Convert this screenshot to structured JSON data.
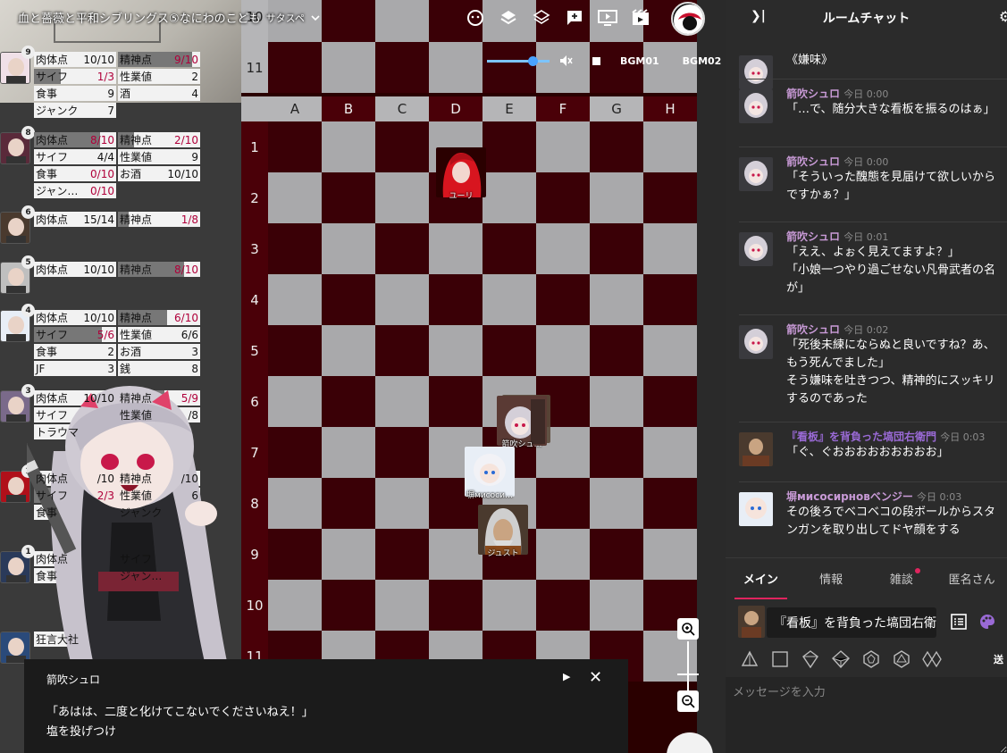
{
  "room": {
    "title": "血と薔薇と平和シブリングス⑤なにわのこども",
    "subtitle": "サタスペ"
  },
  "toolbar": {
    "icons": [
      "face-icon",
      "layers-icon",
      "layers-outline-icon",
      "add-comment-icon",
      "screen-icon",
      "movie-icon"
    ]
  },
  "bgm": {
    "channels": [
      "BGM01",
      "BGM02"
    ]
  },
  "board": {
    "columns": [
      "A",
      "B",
      "C",
      "D",
      "E",
      "F",
      "G",
      "H"
    ],
    "rows_top": [
      "10",
      "11"
    ],
    "rows": [
      "1",
      "2",
      "3",
      "4",
      "5",
      "6",
      "7",
      "8",
      "9",
      "10",
      "11"
    ]
  },
  "tokens": [
    {
      "name": "ユーリ"
    },
    {
      "name": "箭吹シュ…"
    },
    {
      "name": "塀мисоси…"
    },
    {
      "name": "ジュスト"
    }
  ],
  "characters": [
    {
      "badge": "9",
      "stats": [
        [
          "肉体点",
          "10/10"
        ],
        [
          "精神点",
          "9/10"
        ],
        [
          "サイフ",
          "1/3"
        ],
        [
          "性業値",
          "2"
        ],
        [
          "食事",
          "9"
        ],
        [
          "酒",
          "4"
        ],
        [
          "ジャンク",
          "7"
        ]
      ]
    },
    {
      "badge": "8",
      "stats": [
        [
          "肉体点",
          "8/10"
        ],
        [
          "精神点",
          "2/10"
        ],
        [
          "サイフ",
          "4/4"
        ],
        [
          "性業値",
          "9"
        ],
        [
          "食事",
          "0/10"
        ],
        [
          "お酒",
          "10/10"
        ],
        [
          "ジャン…",
          "0/10"
        ]
      ]
    },
    {
      "badge": "6",
      "stats": [
        [
          "肉体点",
          "15/14"
        ],
        [
          "精神点",
          "1/8"
        ]
      ]
    },
    {
      "badge": "5",
      "stats": [
        [
          "肉体点",
          "10/10"
        ],
        [
          "精神点",
          "8/10"
        ]
      ]
    },
    {
      "badge": "4",
      "stats": [
        [
          "肉体点",
          "10/10"
        ],
        [
          "精神点",
          "6/10"
        ],
        [
          "サイフ",
          "5/6"
        ],
        [
          "性業値",
          "6/6"
        ],
        [
          "食事",
          "2"
        ],
        [
          "お酒",
          "3"
        ],
        [
          "JF",
          "3"
        ],
        [
          "銭",
          "8"
        ]
      ]
    },
    {
      "badge": "3",
      "stats": [
        [
          "肉体点",
          "10/10"
        ],
        [
          "精神点",
          "5/9"
        ],
        [
          "サイフ",
          ""
        ],
        [
          "性業値",
          "/8"
        ],
        [
          "トラウマ",
          ""
        ]
      ]
    },
    {
      "badge": "1",
      "stats": [
        [
          "肉体点",
          "/10"
        ],
        [
          "精神点",
          "/10"
        ],
        [
          "サイフ",
          "2/3"
        ],
        [
          "性業値",
          "6"
        ],
        [
          "食事",
          ""
        ],
        [
          "ジャンク",
          ""
        ]
      ]
    },
    {
      "badge": "1",
      "stats": [
        [
          "肉体点",
          ""
        ],
        [
          "サイフ",
          ""
        ],
        [
          "食事",
          ""
        ],
        [
          "ジャン…",
          ""
        ]
      ]
    },
    {
      "badge": "",
      "stats": [
        [
          "狂言大社",
          ""
        ]
      ]
    }
  ],
  "message_box": {
    "speaker": "箭吹シュロ",
    "line1": "「あはは、二度と化けてこないでくださいねえ！」",
    "line2": "塩を投げつけ"
  },
  "chat": {
    "title": "ルームチャット",
    "messages": [
      {
        "name": "箭吹シュロ",
        "time": "今日 0:00",
        "lines": [
          "《嫌味》"
        ]
      },
      {
        "name": "箭吹シュロ",
        "time": "今日 0:00",
        "lines": [
          "「…で、随分大きな看板を振るのはぁ」"
        ]
      },
      {
        "name": "箭吹シュロ",
        "time": "今日 0:00",
        "lines": [
          "「そういった醜態を見届けて欲しいから",
          "ですかぁ？」"
        ]
      },
      {
        "name": "箭吹シュロ",
        "time": "今日 0:01",
        "lines": [
          "「ええ、よぉく見えてますよ？」",
          "「小娘一つやり過ごせない凡骨武者の名",
          "が」"
        ]
      },
      {
        "name": "箭吹シュロ",
        "time": "今日 0:02",
        "lines": [
          "「死後未練にならぬと良いですね？あ、",
          "もう死んでました」",
          "そう嫌味を吐きつつ、精神的にスッキリ",
          "するのであった"
        ]
      },
      {
        "name": "『看板』を背負った塙団右衛門",
        "time": "今日 0:03",
        "lines": [
          "「ぐ、ぐおおおおおおおおお」"
        ]
      },
      {
        "name": "塀мисосирнoвベンジー",
        "time": "今日 0:03",
        "lines": [
          "その後ろでベコベコの段ボールからスタ",
          "ンガンを取り出してドヤ顔をする"
        ]
      }
    ],
    "tabs": [
      "メイン",
      "情報",
      "雑談",
      "匿名さん"
    ],
    "sender_name": "『看板』を背負った塙団右衛",
    "send_label": "送",
    "input_placeholder": "メッセージを入力"
  },
  "colors": {
    "board_red": "#3a0006",
    "board_gray": "#a9a9ab",
    "accent": "#e0245e",
    "name_purple": "#c89ad6",
    "name_violet": "#9a6ad6"
  }
}
